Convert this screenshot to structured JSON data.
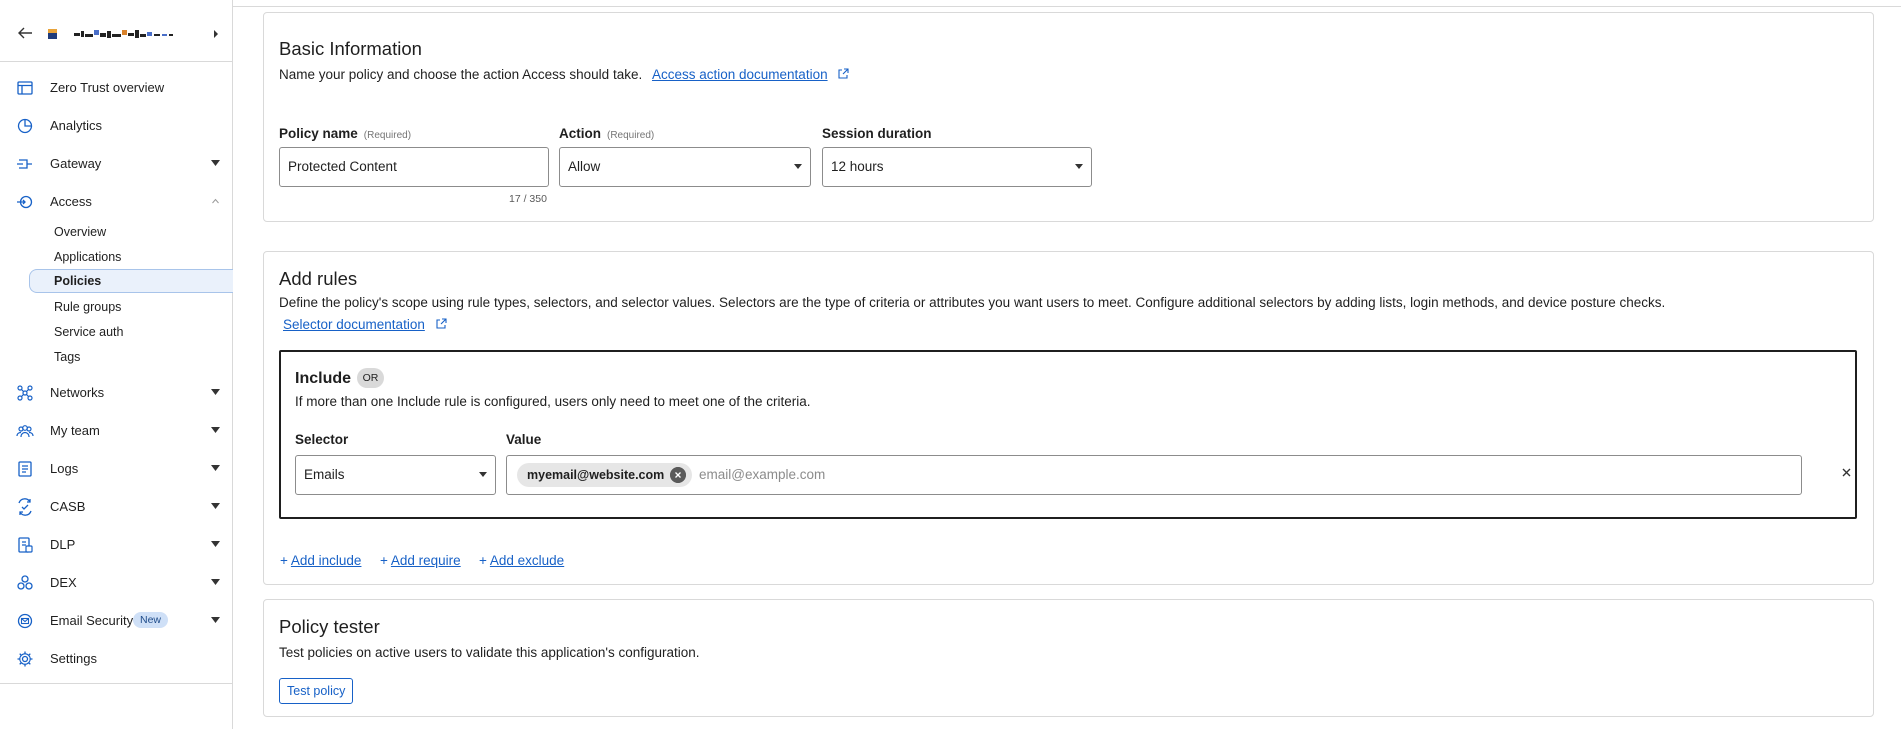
{
  "sidebar": {
    "items": [
      {
        "label": "Zero Trust overview",
        "icon": "window-icon"
      },
      {
        "label": "Analytics",
        "icon": "pie-chart-icon"
      },
      {
        "label": "Gateway",
        "icon": "gateway-icon",
        "expandable": true
      },
      {
        "label": "Access",
        "icon": "access-icon",
        "expanded": true
      },
      {
        "label": "Networks",
        "icon": "network-icon",
        "expandable": true
      },
      {
        "label": "My team",
        "icon": "team-icon",
        "expandable": true
      },
      {
        "label": "Logs",
        "icon": "logs-icon",
        "expandable": true
      },
      {
        "label": "CASB",
        "icon": "casb-icon",
        "expandable": true
      },
      {
        "label": "DLP",
        "icon": "dlp-icon",
        "expandable": true
      },
      {
        "label": "DEX",
        "icon": "dex-icon",
        "expandable": true
      },
      {
        "label": "Email Security",
        "icon": "email-security-icon",
        "expandable": true,
        "badge": "New"
      },
      {
        "label": "Settings",
        "icon": "gear-icon"
      }
    ],
    "access_subitems": [
      "Overview",
      "Applications",
      "Policies",
      "Rule groups",
      "Service auth",
      "Tags"
    ],
    "active_subitem": "Policies"
  },
  "basic_info": {
    "title": "Basic Information",
    "description": "Name your policy and choose the action Access should take.",
    "doc_link": "Access action documentation",
    "policy_name_label": "Policy name",
    "required_tag": "(Required)",
    "policy_name_value": "Protected Content",
    "policy_name_counter": "17 / 350",
    "action_label": "Action",
    "action_value": "Allow",
    "session_label": "Session duration",
    "session_value": "12 hours"
  },
  "add_rules": {
    "title": "Add rules",
    "description": "Define the policy's scope using rule types, selectors, and selector values. Selectors are the type of criteria or attributes you want users to meet. Configure additional selectors by adding lists, login methods, and device posture checks.",
    "doc_link": "Selector documentation",
    "include": {
      "title": "Include",
      "badge": "OR",
      "description": "If more than one Include rule is configured, users only need to meet one of the criteria.",
      "selector_label": "Selector",
      "value_label": "Value",
      "selector_value": "Emails",
      "chip_value": "myemail@website.com",
      "value_placeholder": "email@example.com"
    },
    "add_include": "Add include",
    "add_require": "Add require",
    "add_exclude": "Add exclude"
  },
  "policy_tester": {
    "title": "Policy tester",
    "description": "Test policies on active users to validate this application's configuration.",
    "button": "Test policy"
  },
  "colors": {
    "link": "#1761c7",
    "active_nav_bg": "#eaf1fb",
    "border": "#d9d9d9"
  }
}
